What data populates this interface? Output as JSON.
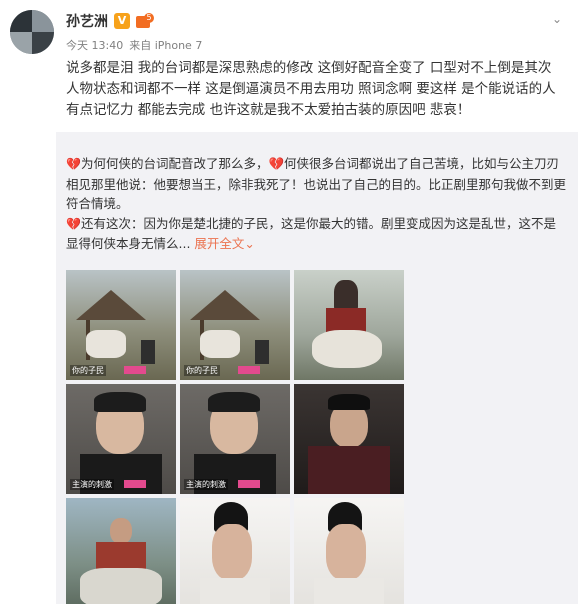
{
  "author": {
    "name": "孙艺洲",
    "verified_badge": "V",
    "member_level": "5",
    "avatar_icon": "avatar-photo"
  },
  "meta": {
    "time": "今天 13:40",
    "source": "来自 iPhone 7"
  },
  "post_text": "说多都是泪 我的台词都是深思熟虑的修改 这倒好配音全变了 口型对不上倒是其次 人物状态和词都不一样 这是倒逼演员不用去用功 照词念啊 要这样 是个能说话的人有点记忆力 都能去完成 也许这就是我不太爱拍古装的原因吧 悲哀！",
  "repost": {
    "line1_prefix": "💔",
    "line1": "为何何侠的台词配音改了那么多，💔何侠很多台词都说出了自己苦境，比如与公主刀刃相见那里他说：他要想当王，除非我死了！也说出了自己的目的。比正剧里那句我做不到更符合情境。",
    "line2_prefix": "💔",
    "line2": "还有这次：因为你是楚北捷的子民，这是你最大的错。剧里变成因为这是乱世，这不是显得何侠本身无情么...",
    "expand_label": "展开全文",
    "expand_icon": "chevron-down-icon"
  },
  "images": [
    {
      "caption": "你的子民",
      "scene": "thatched-hut-horse-scene"
    },
    {
      "caption": "你的子民",
      "scene": "thatched-hut-horse-scene"
    },
    {
      "caption": "",
      "scene": "armored-rider-scene"
    },
    {
      "caption": "主演的刺激",
      "scene": "interview-closeup"
    },
    {
      "caption": "主演的刺激",
      "scene": "interview-closeup"
    },
    {
      "caption": "",
      "scene": "robed-character-scene"
    },
    {
      "caption": "",
      "scene": "battle-rider-scene"
    },
    {
      "caption": "",
      "scene": "white-robe-profile"
    },
    {
      "caption": "",
      "scene": "white-robe-profile"
    }
  ],
  "colors": {
    "accent_orange": "#eb7350",
    "repost_bg": "#f2f2f5",
    "heart_red": "#d9332a"
  }
}
